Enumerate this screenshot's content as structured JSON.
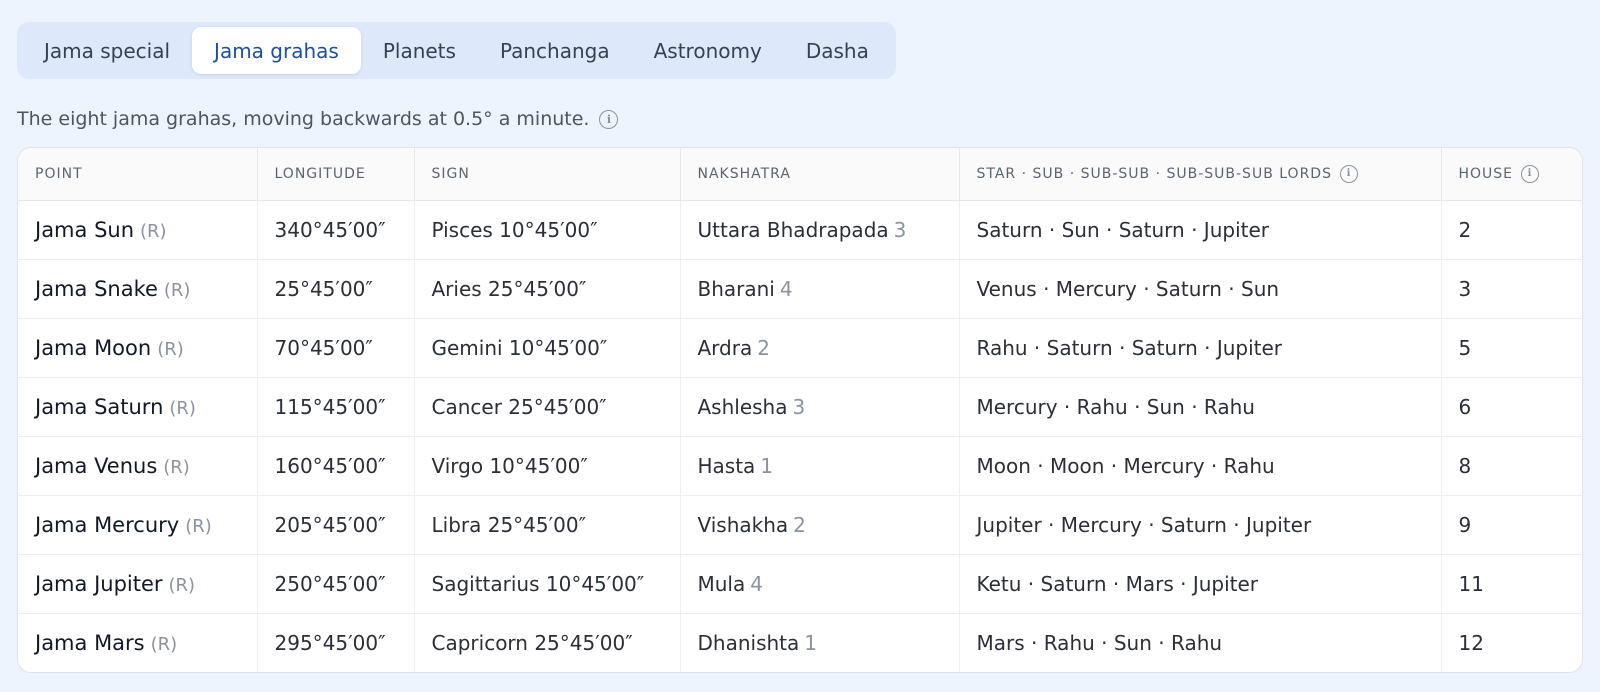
{
  "tabs": [
    {
      "label": "Jama special",
      "active": false
    },
    {
      "label": "Jama grahas",
      "active": true
    },
    {
      "label": "Planets",
      "active": false
    },
    {
      "label": "Panchanga",
      "active": false
    },
    {
      "label": "Astronomy",
      "active": false
    },
    {
      "label": "Dasha",
      "active": false
    }
  ],
  "caption": "The eight jama grahas, moving backwards at 0.5° a minute.",
  "table": {
    "headers": {
      "point": "POINT",
      "longitude": "LONGITUDE",
      "sign": "SIGN",
      "nakshatra": "NAKSHATRA",
      "lords": "STAR · SUB · SUB-SUB · SUB-SUB-SUB LORDS",
      "house": "HOUSE"
    },
    "rows": [
      {
        "point": "Jama Sun",
        "retro": "(R)",
        "longitude": "340°45′00″",
        "sign": "Pisces 10°45′00″",
        "nakshatra": "Uttara Bhadrapada",
        "pada": "3",
        "lords": "Saturn · Sun · Saturn · Jupiter",
        "house": "2"
      },
      {
        "point": "Jama Snake",
        "retro": "(R)",
        "longitude": "25°45′00″",
        "sign": "Aries 25°45′00″",
        "nakshatra": "Bharani",
        "pada": "4",
        "lords": "Venus · Mercury · Saturn · Sun",
        "house": "3"
      },
      {
        "point": "Jama Moon",
        "retro": "(R)",
        "longitude": "70°45′00″",
        "sign": "Gemini 10°45′00″",
        "nakshatra": "Ardra",
        "pada": "2",
        "lords": "Rahu · Saturn · Saturn · Jupiter",
        "house": "5"
      },
      {
        "point": "Jama Saturn",
        "retro": "(R)",
        "longitude": "115°45′00″",
        "sign": "Cancer 25°45′00″",
        "nakshatra": "Ashlesha",
        "pada": "3",
        "lords": "Mercury · Rahu · Sun · Rahu",
        "house": "6"
      },
      {
        "point": "Jama Venus",
        "retro": "(R)",
        "longitude": "160°45′00″",
        "sign": "Virgo 10°45′00″",
        "nakshatra": "Hasta",
        "pada": "1",
        "lords": "Moon · Moon · Mercury · Rahu",
        "house": "8"
      },
      {
        "point": "Jama Mercury",
        "retro": "(R)",
        "longitude": "205°45′00″",
        "sign": "Libra 25°45′00″",
        "nakshatra": "Vishakha",
        "pada": "2",
        "lords": "Jupiter · Mercury · Saturn · Jupiter",
        "house": "9"
      },
      {
        "point": "Jama Jupiter",
        "retro": "(R)",
        "longitude": "250°45′00″",
        "sign": "Sagittarius 10°45′00″",
        "nakshatra": "Mula",
        "pada": "4",
        "lords": "Ketu · Saturn · Mars · Jupiter",
        "house": "11"
      },
      {
        "point": "Jama Mars",
        "retro": "(R)",
        "longitude": "295°45′00″",
        "sign": "Capricorn 25°45′00″",
        "nakshatra": "Dhanishta",
        "pada": "1",
        "lords": "Mars · Rahu · Sun · Rahu",
        "house": "12"
      }
    ]
  }
}
